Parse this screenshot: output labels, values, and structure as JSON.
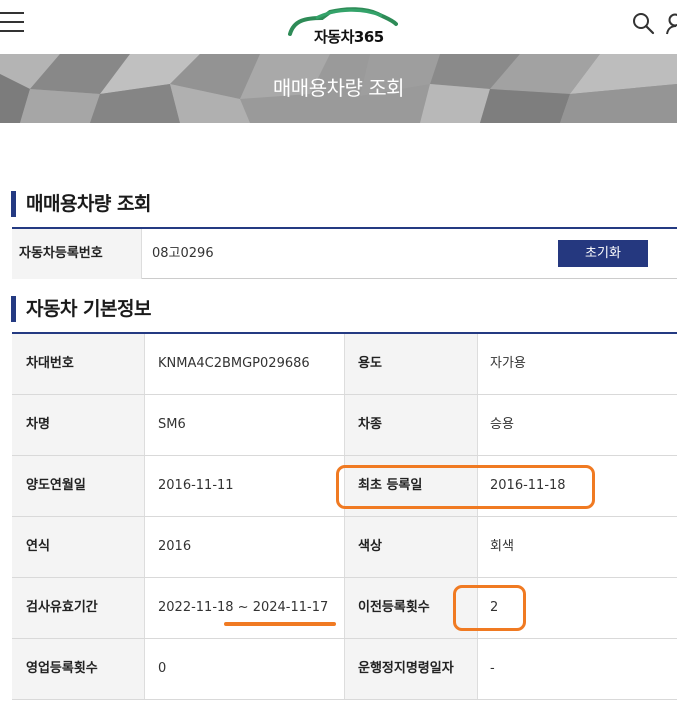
{
  "header": {
    "logo_text": "자동차365",
    "menu_icon": "hamburger-menu-icon",
    "search_icon": "search-icon",
    "user_icon": "user-icon"
  },
  "banner": {
    "title": "매매용차량 조회"
  },
  "search_section": {
    "title": "매매용차량 조회",
    "field_label": "자동차등록번호",
    "field_value": "08고0296",
    "reset_label": "초기화"
  },
  "info_section": {
    "title": "자동차 기본정보",
    "rows": [
      {
        "label1": "차대번호",
        "value1": "KNMA4C2BMGP029686",
        "label2": "용도",
        "value2": "자가용"
      },
      {
        "label1": "차명",
        "value1": "SM6",
        "label2": "차종",
        "value2": "승용"
      },
      {
        "label1": "양도연월일",
        "value1": "2016-11-11",
        "label2": "최초 등록일",
        "value2": "2016-11-18"
      },
      {
        "label1": "연식",
        "value1": "2016",
        "label2": "색상",
        "value2": "회색"
      },
      {
        "label1": "검사유효기간",
        "value1": "2022-11-18 ~ 2024-11-17",
        "label2": "이전등록횟수",
        "value2": "2"
      },
      {
        "label1": "영업등록횟수",
        "value1": "0",
        "label2": "운행정지명령일자",
        "value2": "-"
      }
    ]
  },
  "colors": {
    "navy": "#243a82",
    "highlight": "#f07a22",
    "banner": "#8f8f8f"
  }
}
